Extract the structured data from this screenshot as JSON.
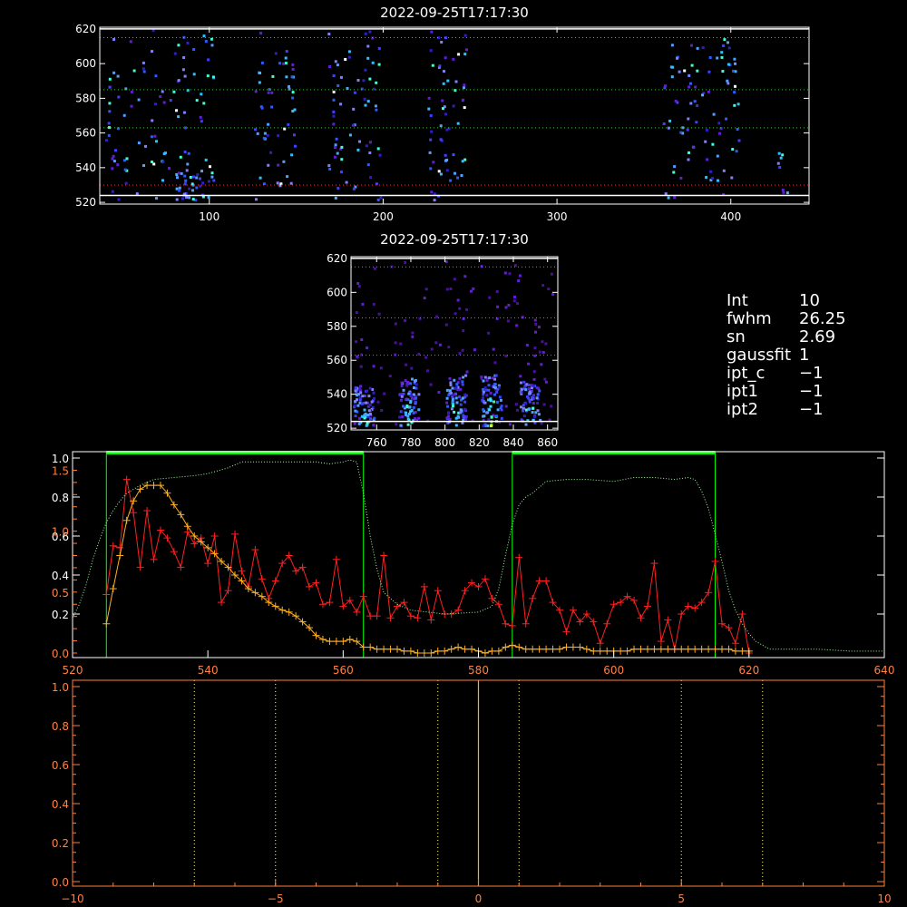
{
  "colors": {
    "background": "#000000",
    "axis_white": "#ffffff",
    "axis_orange": "#ff8040",
    "red_series": "#ff2020",
    "orange_series": "#ffb020",
    "green_box": "#00ff00",
    "green_dotted": "#a0ffa0",
    "guide_dotted": "#ffff90"
  },
  "params": [
    {
      "key": "Int",
      "value": "10"
    },
    {
      "key": "fwhm",
      "value": "26.25"
    },
    {
      "key": "sn",
      "value": "2.69"
    },
    {
      "key": "gaussfit",
      "value": "1"
    },
    {
      "key": "ipt_c",
      "value": "−1"
    },
    {
      "key": "ipt1",
      "value": "−1"
    },
    {
      "key": "ipt2",
      "value": "−1"
    }
  ],
  "chart_data": [
    {
      "type": "heatmap",
      "title": "2022-09-25T17:17:30",
      "xlim": [
        37,
        445
      ],
      "ylim": [
        519,
        621
      ],
      "x_ticks": [
        100,
        200,
        300,
        400
      ],
      "y_ticks": [
        520,
        540,
        560,
        580,
        600,
        620
      ],
      "guide_lines_y": [
        524,
        530,
        563,
        585,
        615,
        620
      ],
      "clusters": [
        {
          "x": [
            40,
            105
          ],
          "y": [
            522,
            620
          ],
          "count": 110,
          "seed": 3
        },
        {
          "x": [
            80,
            96
          ],
          "y": [
            522,
            540
          ],
          "count": 30,
          "seed": 4
        },
        {
          "x": [
            125,
            150
          ],
          "y": [
            522,
            620
          ],
          "count": 55,
          "seed": 5
        },
        {
          "x": [
            168,
            198
          ],
          "y": [
            522,
            620
          ],
          "count": 70,
          "seed": 6
        },
        {
          "x": [
            225,
            248
          ],
          "y": [
            522,
            620
          ],
          "count": 60,
          "seed": 7
        },
        {
          "x": [
            358,
            405
          ],
          "y": [
            522,
            620
          ],
          "count": 90,
          "seed": 8
        },
        {
          "x": [
            425,
            432
          ],
          "y": [
            522,
            552
          ],
          "count": 8,
          "seed": 9
        }
      ]
    },
    {
      "type": "heatmap",
      "title": "2022-09-25T17:17:30",
      "xlim": [
        745,
        866
      ],
      "ylim": [
        519,
        621
      ],
      "x_ticks": [
        760,
        780,
        800,
        820,
        840,
        860
      ],
      "y_ticks": [
        520,
        540,
        560,
        580,
        600,
        620
      ],
      "guide_lines_y": [
        524,
        563,
        585,
        615,
        620
      ],
      "background_count": 140,
      "bright_columns": [
        {
          "x": 752,
          "y": [
            522,
            545
          ]
        },
        {
          "x": 778,
          "y": [
            522,
            550
          ]
        },
        {
          "x": 806,
          "y": [
            522,
            552
          ]
        },
        {
          "x": 827,
          "y": [
            522,
            552
          ]
        },
        {
          "x": 849,
          "y": [
            522,
            548
          ]
        }
      ]
    },
    {
      "type": "line",
      "xlim": [
        520,
        640
      ],
      "x_ticks": [
        520,
        540,
        560,
        580,
        600,
        620,
        640
      ],
      "left_ticks_white": [
        0.2,
        0.4,
        0.6,
        0.8,
        1.0
      ],
      "left_ticks_orange": [
        0.0,
        0.5,
        1.0,
        1.5
      ],
      "green_boxes": [
        [
          525,
          563
        ],
        [
          585,
          615
        ]
      ],
      "series": [
        {
          "color": "red",
          "x": [
            525,
            526,
            527,
            528,
            529,
            530,
            531,
            532,
            533,
            534,
            535,
            536,
            537,
            538,
            539,
            540,
            541,
            542,
            543,
            544,
            545,
            546,
            547,
            548,
            549,
            550,
            551,
            552,
            553,
            554,
            555,
            556,
            557,
            558,
            559,
            560,
            561,
            562,
            563,
            564,
            565,
            566,
            567,
            568,
            569,
            570,
            571,
            572,
            573,
            574,
            575,
            576,
            577,
            578,
            579,
            580,
            581,
            582,
            583,
            584,
            585,
            586,
            587,
            588,
            589,
            590,
            591,
            592,
            593,
            594,
            595,
            596,
            597,
            598,
            599,
            600,
            601,
            602,
            603,
            604,
            605,
            606,
            607,
            608,
            609,
            610,
            611,
            612,
            613,
            614,
            615,
            616,
            617,
            618,
            619,
            620
          ],
          "y": [
            0.3,
            0.55,
            0.54,
            0.89,
            0.72,
            0.44,
            0.73,
            0.48,
            0.63,
            0.59,
            0.52,
            0.44,
            0.62,
            0.56,
            0.59,
            0.46,
            0.6,
            0.26,
            0.32,
            0.61,
            0.42,
            0.34,
            0.53,
            0.38,
            0.28,
            0.37,
            0.46,
            0.5,
            0.42,
            0.44,
            0.34,
            0.36,
            0.25,
            0.26,
            0.48,
            0.24,
            0.27,
            0.21,
            0.29,
            0.19,
            0.19,
            0.5,
            0.18,
            0.24,
            0.26,
            0.19,
            0.18,
            0.34,
            0.17,
            0.32,
            0.2,
            0.2,
            0.22,
            0.32,
            0.36,
            0.34,
            0.38,
            0.28,
            0.25,
            0.15,
            0.14,
            0.49,
            0.15,
            0.28,
            0.37,
            0.37,
            0.26,
            0.22,
            0.11,
            0.22,
            0.16,
            0.2,
            0.16,
            0.05,
            0.15,
            0.25,
            0.26,
            0.29,
            0.27,
            0.18,
            0.24,
            0.46,
            0.06,
            0.17,
            0.02,
            0.2,
            0.24,
            0.23,
            0.26,
            0.31,
            0.47,
            0.15,
            0.13,
            0.05,
            0.2,
            0.0
          ]
        },
        {
          "color": "orange",
          "x": [
            525,
            526,
            527,
            528,
            529,
            530,
            531,
            532,
            533,
            534,
            535,
            536,
            537,
            538,
            539,
            540,
            541,
            542,
            543,
            544,
            545,
            546,
            547,
            548,
            549,
            550,
            551,
            552,
            553,
            554,
            555,
            556,
            557,
            558,
            559,
            560,
            561,
            562,
            563,
            564,
            565,
            566,
            567,
            568,
            569,
            570,
            571,
            572,
            573,
            574,
            575,
            576,
            577,
            578,
            579,
            580,
            581,
            582,
            583,
            584,
            585,
            586,
            587,
            588,
            589,
            590,
            591,
            592,
            593,
            594,
            595,
            596,
            597,
            598,
            599,
            600,
            601,
            602,
            603,
            604,
            605,
            606,
            607,
            608,
            609,
            610,
            611,
            612,
            613,
            614,
            615,
            616,
            617,
            618,
            619,
            620
          ],
          "y": [
            0.15,
            0.33,
            0.5,
            0.68,
            0.78,
            0.84,
            0.86,
            0.86,
            0.86,
            0.82,
            0.76,
            0.71,
            0.65,
            0.6,
            0.57,
            0.54,
            0.51,
            0.47,
            0.44,
            0.4,
            0.37,
            0.33,
            0.31,
            0.29,
            0.26,
            0.24,
            0.22,
            0.21,
            0.19,
            0.16,
            0.13,
            0.09,
            0.07,
            0.06,
            0.06,
            0.06,
            0.07,
            0.06,
            0.03,
            0.03,
            0.02,
            0.02,
            0.02,
            0.02,
            0.01,
            0.01,
            0.0,
            0.0,
            0.0,
            0.01,
            0.01,
            0.02,
            0.03,
            0.02,
            0.02,
            0.01,
            0.0,
            0.01,
            0.01,
            0.03,
            0.04,
            0.03,
            0.02,
            0.02,
            0.02,
            0.02,
            0.02,
            0.02,
            0.03,
            0.03,
            0.03,
            0.02,
            0.01,
            0.01,
            0.01,
            0.01,
            0.01,
            0.01,
            0.02,
            0.02,
            0.02,
            0.02,
            0.02,
            0.02,
            0.02,
            0.02,
            0.02,
            0.02,
            0.02,
            0.02,
            0.02,
            0.02,
            0.02,
            0.01,
            0.01,
            0.01
          ]
        },
        {
          "color": "green-dotted",
          "x": [
            520,
            521,
            522,
            523,
            524,
            525,
            526,
            527,
            528,
            530,
            532,
            535,
            538,
            540,
            543,
            545,
            548,
            550,
            553,
            556,
            558,
            560,
            561,
            562,
            563,
            564,
            565,
            566,
            568,
            570,
            575,
            580,
            582,
            583,
            584,
            585,
            586,
            587,
            588,
            590,
            593,
            596,
            600,
            603,
            606,
            609,
            611,
            612,
            613,
            614,
            615,
            616,
            617,
            618,
            619,
            620,
            621,
            622,
            623,
            625,
            630,
            635,
            640
          ],
          "y": [
            0.18,
            0.25,
            0.35,
            0.48,
            0.58,
            0.67,
            0.73,
            0.78,
            0.82,
            0.86,
            0.89,
            0.9,
            0.91,
            0.92,
            0.95,
            0.98,
            0.98,
            0.98,
            0.98,
            0.98,
            0.97,
            0.98,
            0.99,
            0.98,
            0.82,
            0.6,
            0.43,
            0.31,
            0.25,
            0.22,
            0.2,
            0.21,
            0.24,
            0.33,
            0.5,
            0.66,
            0.76,
            0.8,
            0.82,
            0.88,
            0.89,
            0.89,
            0.88,
            0.9,
            0.9,
            0.89,
            0.9,
            0.89,
            0.83,
            0.74,
            0.61,
            0.47,
            0.32,
            0.22,
            0.15,
            0.1,
            0.06,
            0.04,
            0.02,
            0.02,
            0.02,
            0.01,
            0.01
          ]
        }
      ]
    },
    {
      "type": "line",
      "xlim": [
        -10,
        10
      ],
      "x_ticks": [
        -10,
        -5,
        0,
        5,
        10
      ],
      "y_ticks": [
        0.0,
        0.2,
        0.4,
        0.6,
        0.8,
        1.0
      ],
      "dotted_vertical_x": [
        -7,
        -5,
        -1,
        1,
        5,
        7
      ],
      "solid_vertical_x": [
        0
      ]
    }
  ]
}
